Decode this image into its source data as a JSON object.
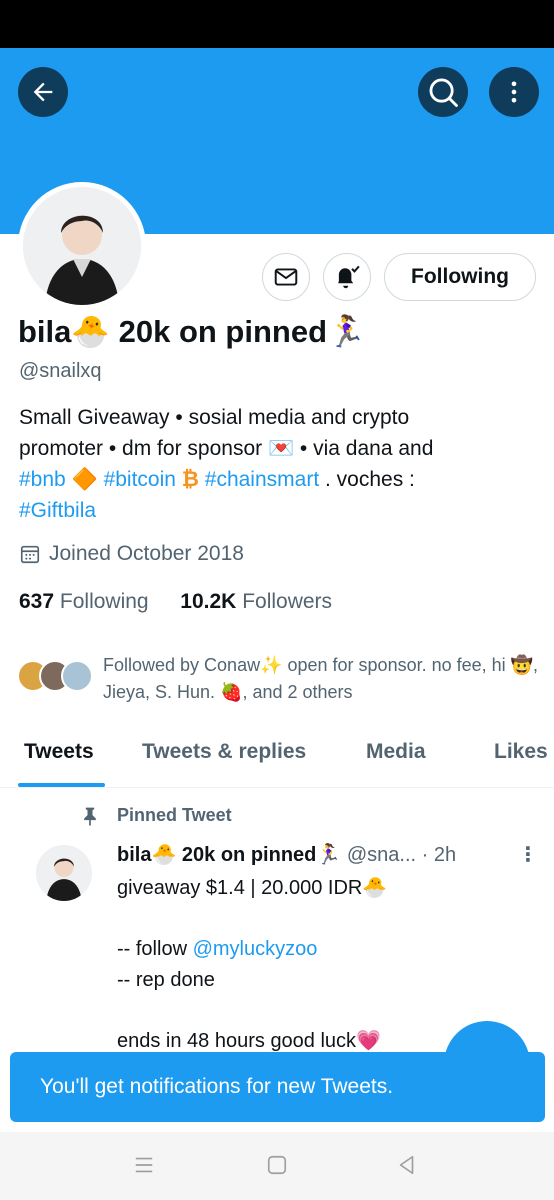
{
  "profile": {
    "name": "bila🐣 20k on pinned🏃‍♀️",
    "handle": "@snailxq",
    "bio": {
      "line1": "Small Giveaway • sosial media and crypto",
      "line2": "promoter • dm for sponsor 💌 • via dana and",
      "tag_bnb": "#bnb",
      "bnb_emoji": "🔶",
      "tag_bitcoin": "#bitcoin",
      "bitcoin_emoji": "₿",
      "tag_chainsmart": "#chainsmart",
      "after_tags": " . voches :",
      "tag_gift": "#Giftbila"
    },
    "joined": "Joined October 2018",
    "following_count": "637",
    "following_label": "Following",
    "followers_count": "10.2K",
    "followers_label": "Followers",
    "followed_by": "Followed by Conaw✨ open for sponsor. no fee, hi 🤠, Jieya, S. Hun. 🍓, and 2 others"
  },
  "actions": {
    "following_button": "Following"
  },
  "tabs": [
    {
      "label": "Tweets"
    },
    {
      "label": "Tweets & replies"
    },
    {
      "label": "Media"
    },
    {
      "label": "Likes"
    }
  ],
  "pinned_tweet": {
    "label": "Pinned Tweet",
    "author_name": "bila🐣 20k on pinned🏃‍♀️",
    "author_meta": "@sna... · 2h",
    "text_line1": "giveaway $1.4 | 20.000 IDR🐣",
    "text_follow_prefix": "-- follow ",
    "text_mention": "@myluckyzoo",
    "text_line3": "-- rep done",
    "text_line4": "ends in 48 hours good luck💗"
  },
  "toast": {
    "message": "You'll get notifications for new Tweets."
  },
  "colors": {
    "accent": "#1d9bf0",
    "dark_button": "#0f3c5a"
  }
}
